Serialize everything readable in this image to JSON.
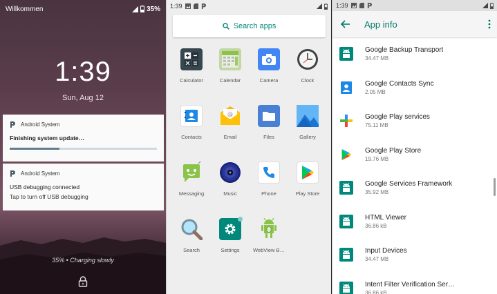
{
  "lock_screen": {
    "carrier": "Willkommen",
    "battery": "35%",
    "time": "1:39",
    "date": "Sun, Aug 12",
    "notifications": [
      {
        "app": "Android System",
        "title": "Finishing system update…",
        "progress": 0.34
      },
      {
        "app": "Android System",
        "title": "USB debugging connected",
        "text": "Tap to turn off USB debugging"
      }
    ],
    "charging": "35% • Charging slowly"
  },
  "drawer": {
    "time": "1:39",
    "search_placeholder": "Search apps",
    "apps": [
      {
        "label": "Calculator",
        "icon": "calculator-icon"
      },
      {
        "label": "Calendar",
        "icon": "calendar-icon"
      },
      {
        "label": "Camera",
        "icon": "camera-icon"
      },
      {
        "label": "Clock",
        "icon": "clock-icon"
      },
      {
        "label": "Contacts",
        "icon": "contacts-icon"
      },
      {
        "label": "Email",
        "icon": "email-icon"
      },
      {
        "label": "Files",
        "icon": "files-icon"
      },
      {
        "label": "Gallery",
        "icon": "gallery-icon"
      },
      {
        "label": "Messaging",
        "icon": "messaging-icon"
      },
      {
        "label": "Music",
        "icon": "music-icon"
      },
      {
        "label": "Phone",
        "icon": "phone-icon"
      },
      {
        "label": "Play Store",
        "icon": "play-store-icon"
      },
      {
        "label": "Search",
        "icon": "search-icon"
      },
      {
        "label": "Settings",
        "icon": "settings-icon"
      },
      {
        "label": "WebView B…",
        "icon": "webview-icon"
      }
    ]
  },
  "app_info": {
    "time": "1:39",
    "title": "App info",
    "apps": [
      {
        "name": "Google Backup Transport",
        "size": "34.47 MB",
        "icon": "android-icon"
      },
      {
        "name": "Google Contacts Sync",
        "size": "2.05 MB",
        "icon": "contacts-sync-icon"
      },
      {
        "name": "Google Play services",
        "size": "75.11 MB",
        "icon": "play-services-icon"
      },
      {
        "name": "Google Play Store",
        "size": "19.76 MB",
        "icon": "play-store-icon"
      },
      {
        "name": "Google Services Framework",
        "size": "35.92 MB",
        "icon": "android-icon"
      },
      {
        "name": "HTML Viewer",
        "size": "36.86 kB",
        "icon": "android-icon"
      },
      {
        "name": "Input Devices",
        "size": "34.47 MB",
        "icon": "android-icon"
      },
      {
        "name": "Intent Filter Verification Ser…",
        "size": "36.86 kB",
        "icon": "android-icon"
      }
    ]
  },
  "colors": {
    "accent": "#00897b",
    "android_green": "#00897b"
  }
}
